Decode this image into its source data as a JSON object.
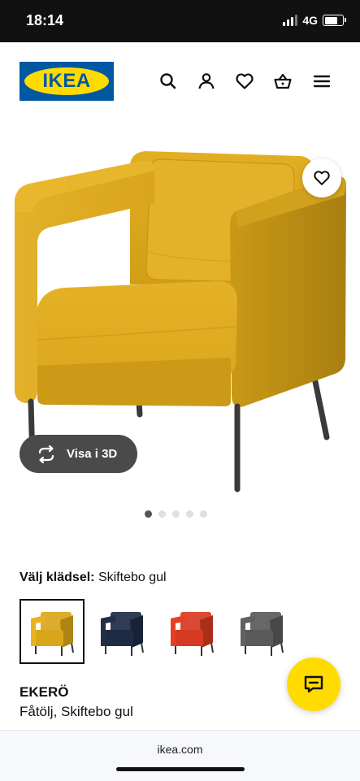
{
  "status_bar": {
    "time": "18:14",
    "network": "4G"
  },
  "header": {
    "logo_text": "IKEA",
    "icons": [
      "search-icon",
      "user-icon",
      "heart-icon",
      "basket-icon",
      "menu-icon"
    ]
  },
  "gallery": {
    "view_3d_label": "Visa i 3D",
    "dot_count": 5,
    "active_dot": 1
  },
  "upholstery": {
    "label": "Välj klädsel:",
    "selected_value": "Skiftebo gul",
    "swatches": [
      {
        "color": "#d9a61a",
        "selected": true
      },
      {
        "color": "#1e2b45",
        "selected": false
      },
      {
        "color": "#d63a23",
        "selected": false
      },
      {
        "color": "#5a5a5a",
        "selected": false
      }
    ]
  },
  "product": {
    "name": "EKERÖ",
    "description": "Fåtölj, Skiftebo gul"
  },
  "browser": {
    "url": "ikea.com"
  },
  "colors": {
    "ikea_blue": "#0058a3",
    "ikea_yellow": "#ffdb00",
    "chair_yellow": "#d9a61a"
  }
}
